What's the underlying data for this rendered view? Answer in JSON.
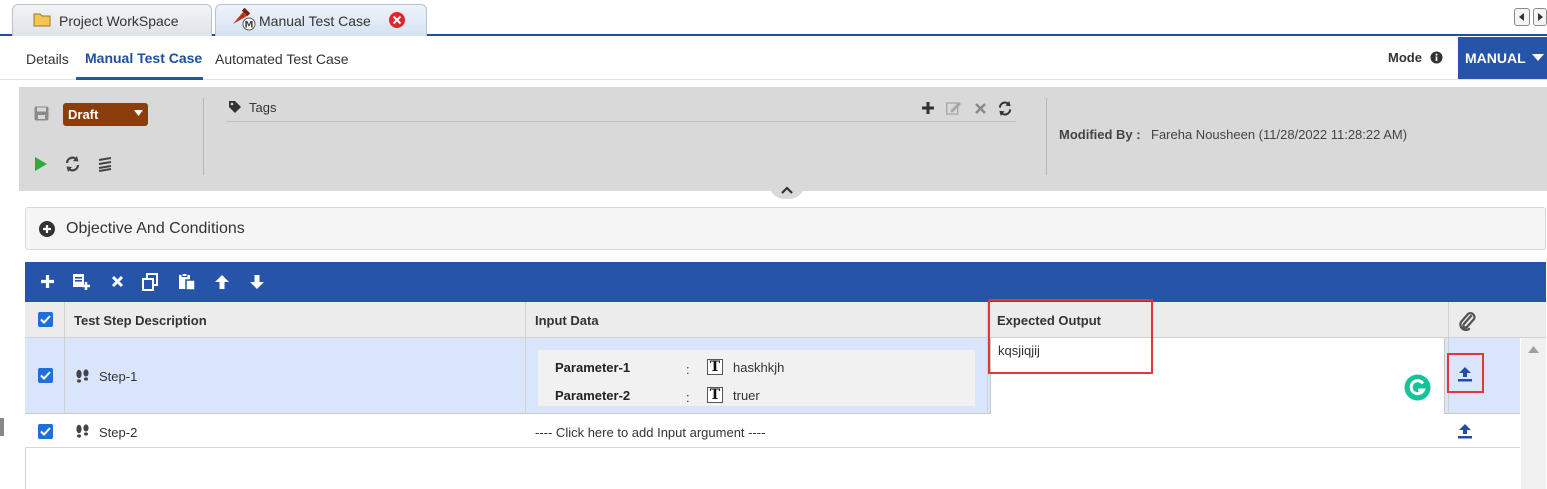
{
  "window_tabs": [
    {
      "label": "Project WorkSpace",
      "icon": "folder-icon"
    },
    {
      "label": "Manual Test Case",
      "icon": "manual-test-icon",
      "closable": true
    }
  ],
  "subtabs": [
    "Details",
    "Manual Test Case",
    "Automated Test Case"
  ],
  "active_subtab": "Manual Test Case",
  "mode": {
    "label": "Mode",
    "value": "MANUAL"
  },
  "toolbar": {
    "status": "Draft",
    "tags_label": "Tags",
    "modified_by_label": "Modified By :",
    "modified_by_value": "Fareha Nousheen (11/28/2022 11:28:22 AM)"
  },
  "objective": {
    "label": "Objective And Conditions"
  },
  "grid": {
    "headers": {
      "description": "Test Step Description",
      "input": "Input Data",
      "expected": "Expected Output"
    },
    "rows": [
      {
        "step": "Step-1",
        "checked": true,
        "params": [
          {
            "name": "Parameter-1",
            "sep": ":",
            "value": "haskhkjh"
          },
          {
            "name": "Parameter-2",
            "sep": ":",
            "value": "truer"
          }
        ],
        "expected": "kqsjiqjij"
      },
      {
        "step": "Step-2",
        "checked": true,
        "input_placeholder": "---- Click here to add Input argument ----",
        "expected": ""
      }
    ]
  },
  "colors": {
    "primary_blue": "#2554a8",
    "draft_brown": "#8b3d0c",
    "highlight_red": "#e2373b",
    "selected_row": "#d9e5fb",
    "grammarly_green": "#15c39a"
  }
}
